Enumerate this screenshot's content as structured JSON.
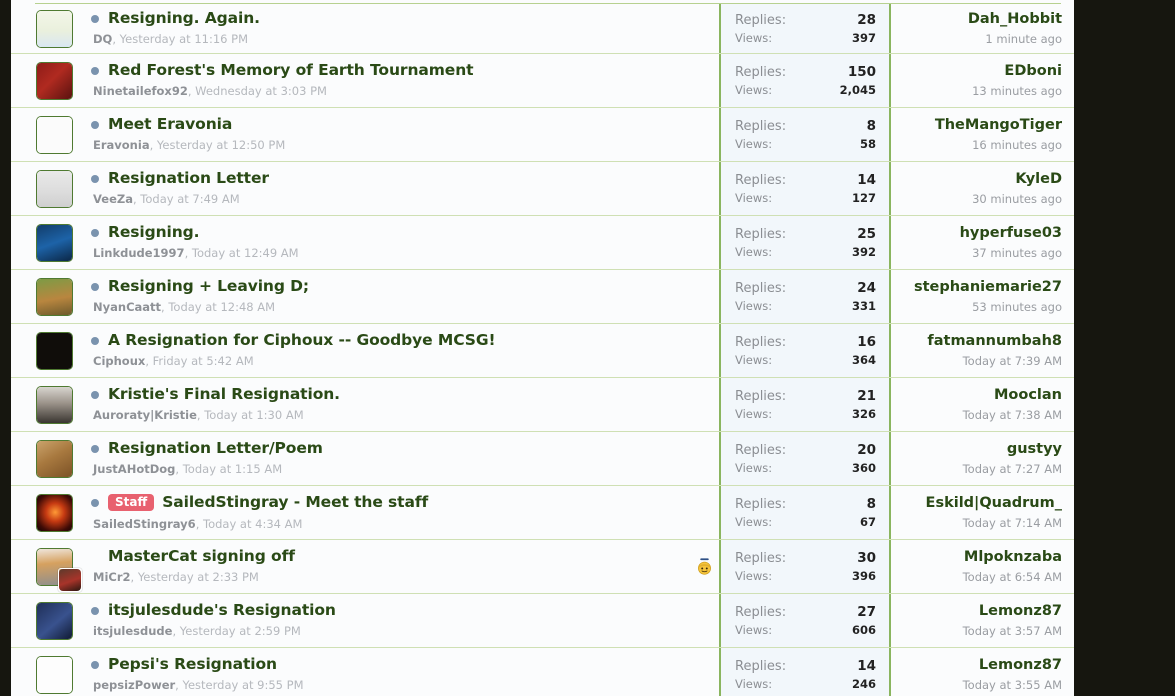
{
  "page": {
    "list_type": "forum-thread-list",
    "labels": {
      "replies": "Replies:",
      "views": "Views:"
    }
  },
  "threads": [
    {
      "title": "Resigning. Again.",
      "prefix": "",
      "author": "DQ",
      "author_sep": ", ",
      "date": "Yesterday at 11:16 PM",
      "replies": "28",
      "views": "397",
      "last_user": "Dah_Hobbit",
      "last_time": "1 minute ago",
      "unread": true,
      "emoticon": "",
      "avatar_class": "art-dq",
      "mini_avatar": false
    },
    {
      "title": "Red Forest's Memory of Earth Tournament",
      "prefix": "",
      "author": "Ninetailefox92",
      "author_sep": ", ",
      "date": "Wednesday at 3:03 PM",
      "replies": "150",
      "views": "2,045",
      "last_user": "EDboni",
      "last_time": "13 minutes ago",
      "unread": true,
      "emoticon": "",
      "avatar_class": "art-ninetail",
      "mini_avatar": false
    },
    {
      "title": "Meet Eravonia",
      "prefix": "",
      "author": "Eravonia",
      "author_sep": ", ",
      "date": "Yesterday at 12:50 PM",
      "replies": "8",
      "views": "58",
      "last_user": "TheMangoTiger",
      "last_time": "16 minutes ago",
      "unread": true,
      "emoticon": "",
      "avatar_class": "art-eravonia",
      "mini_avatar": false
    },
    {
      "title": "Resignation Letter",
      "prefix": "",
      "author": "VeeZa",
      "author_sep": ", ",
      "date": "Today at 7:49 AM",
      "replies": "14",
      "views": "127",
      "last_user": "KyleD",
      "last_time": "30 minutes ago",
      "unread": true,
      "emoticon": "",
      "avatar_class": "art-veeza",
      "mini_avatar": false
    },
    {
      "title": "Resigning.",
      "prefix": "",
      "author": "Linkdude1997",
      "author_sep": ", ",
      "date": "Today at 12:49 AM",
      "replies": "25",
      "views": "392",
      "last_user": "hyperfuse03",
      "last_time": "37 minutes ago",
      "unread": true,
      "emoticon": "",
      "avatar_class": "art-linkdude",
      "mini_avatar": false
    },
    {
      "title": "Resigning + Leaving D;",
      "prefix": "",
      "author": "NyanCaatt",
      "author_sep": ", ",
      "date": "Today at 12:48 AM",
      "replies": "24",
      "views": "331",
      "last_user": "stephaniemarie27",
      "last_time": "53 minutes ago",
      "unread": true,
      "emoticon": "",
      "avatar_class": "art-nyancaatt",
      "mini_avatar": false
    },
    {
      "title": "A Resignation for Ciphoux -- Goodbye MCSG!",
      "prefix": "",
      "author": "Ciphoux",
      "author_sep": ", ",
      "date": "Friday at 5:42 AM",
      "replies": "16",
      "views": "364",
      "last_user": "fatmannumbah8",
      "last_time": "Today at 7:39 AM",
      "unread": true,
      "emoticon": "",
      "avatar_class": "art-ciphoux",
      "mini_avatar": false
    },
    {
      "title": "Kristie's Final Resignation.",
      "prefix": "",
      "author": "Auroraty|Kristie",
      "author_sep": ", ",
      "date": "Today at 1:30 AM",
      "replies": "21",
      "views": "326",
      "last_user": "Mooclan",
      "last_time": "Today at 7:38 AM",
      "unread": true,
      "emoticon": "",
      "avatar_class": "art-kristie",
      "mini_avatar": false
    },
    {
      "title": "Resignation Letter/Poem",
      "prefix": "",
      "author": "JustAHotDog",
      "author_sep": ", ",
      "date": "Today at 1:15 AM",
      "replies": "20",
      "views": "360",
      "last_user": "gustyy",
      "last_time": "Today at 7:27 AM",
      "unread": true,
      "emoticon": "",
      "avatar_class": "art-hotdog",
      "mini_avatar": false
    },
    {
      "title": "SailedStingray - Meet the staff",
      "prefix": "Staff",
      "author": "SailedStingray6",
      "author_sep": ", ",
      "date": "Today at 4:34 AM",
      "replies": "8",
      "views": "67",
      "last_user": "Eskild|Quadrum_",
      "last_time": "Today at 7:14 AM",
      "unread": true,
      "emoticon": "",
      "avatar_class": "art-stingray",
      "mini_avatar": false
    },
    {
      "title": "MasterCat signing off",
      "prefix": "",
      "author": "MiCr2",
      "author_sep": ", ",
      "date": "Yesterday at 2:33 PM",
      "replies": "30",
      "views": "396",
      "last_user": "Mlpoknzaba",
      "last_time": "Today at 6:54 AM",
      "unread": false,
      "emoticon": "smiley-emoticon",
      "avatar_class": "art-mastercat",
      "mini_avatar": true
    },
    {
      "title": "itsjulesdude's Resignation",
      "prefix": "",
      "author": "itsjulesdude",
      "author_sep": ", ",
      "date": "Yesterday at 2:59 PM",
      "replies": "27",
      "views": "606",
      "last_user": "Lemonz87",
      "last_time": "Today at 3:57 AM",
      "unread": true,
      "emoticon": "",
      "avatar_class": "art-jules",
      "mini_avatar": false
    },
    {
      "title": "Pepsi's Resignation",
      "prefix": "",
      "author": "pepsizPower",
      "author_sep": ", ",
      "date": "Yesterday at 9:55 PM",
      "replies": "14",
      "views": "246",
      "last_user": "Lemonz87",
      "last_time": "Today at 3:55 AM",
      "unread": true,
      "emoticon": "",
      "avatar_class": "art-pepsi",
      "mini_avatar": false
    }
  ],
  "colors": {
    "title_green": "#2a4a16",
    "row_border_green": "#cfe0b4",
    "stats_bg": "#f2f7fb",
    "stats_divider": "#8ab55f",
    "badge_staff": "#e8616f",
    "unread_dot": "#7a93ae",
    "page_bg": "#fbfcfd",
    "outside_bg": "#16160f"
  }
}
